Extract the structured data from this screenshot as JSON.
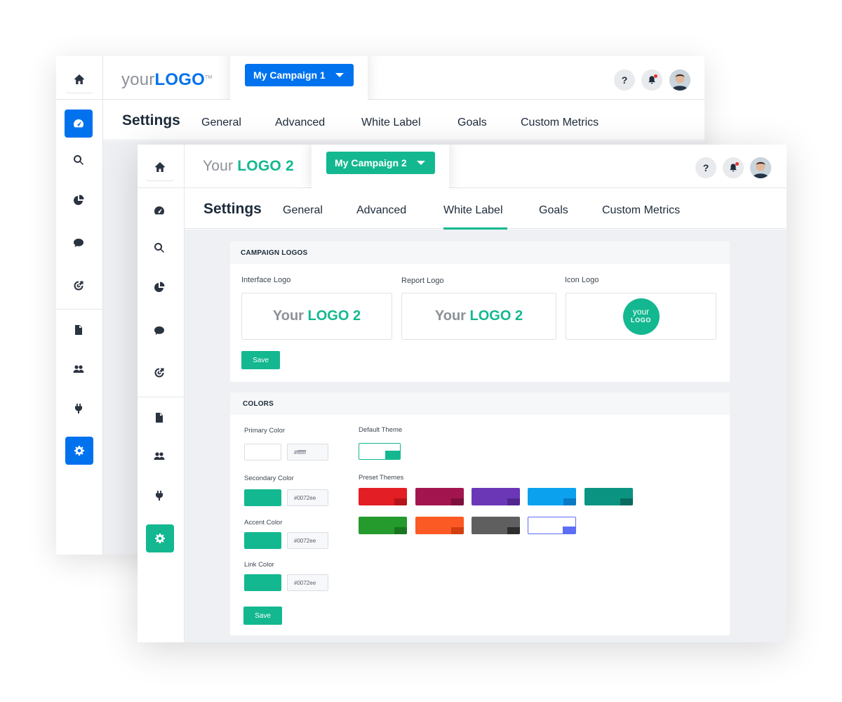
{
  "window1": {
    "logo": {
      "part1": "your",
      "part2": "LOGO",
      "trademark": "TM"
    },
    "campaign_dropdown": {
      "label": "My Campaign 1"
    },
    "header_icons": {
      "help": "?",
      "notifications": "bell-icon",
      "avatar": "avatar"
    },
    "settings_title": "Settings",
    "tabs": [
      {
        "label": "General"
      },
      {
        "label": "Advanced"
      },
      {
        "label": "White Label"
      },
      {
        "label": "Goals"
      },
      {
        "label": "Custom Metrics"
      }
    ],
    "sidebar": [
      "home-icon",
      "dashboard-icon",
      "search-icon",
      "pie-chart-icon",
      "chat-icon",
      "target-icon",
      "file-icon",
      "users-icon",
      "plug-icon",
      "settings-icon"
    ],
    "accent": "#0072ee"
  },
  "window2": {
    "logo": {
      "part1": "Your",
      "part2": "LOGO 2"
    },
    "campaign_dropdown": {
      "label": "My Campaign 2"
    },
    "header_icons": {
      "help": "?",
      "notifications": "bell-icon",
      "avatar": "avatar"
    },
    "settings_title": "Settings",
    "tabs": [
      {
        "label": "General"
      },
      {
        "label": "Advanced"
      },
      {
        "label": "White Label",
        "active": true
      },
      {
        "label": "Goals"
      },
      {
        "label": "Custom Metrics"
      }
    ],
    "sidebar": [
      "home-icon",
      "dashboard-icon",
      "search-icon",
      "pie-chart-icon",
      "chat-icon",
      "target-icon",
      "file-icon",
      "users-icon",
      "plug-icon",
      "settings-icon"
    ],
    "accent": "#13b890",
    "campaign_logos": {
      "heading": "CAMPAIGN LOGOS",
      "interface_logo": {
        "label": "Interface Logo",
        "part1": "Your",
        "part2": "LOGO 2"
      },
      "report_logo": {
        "label": "Report Logo",
        "part1": "Your",
        "part2": "LOGO 2"
      },
      "icon_logo": {
        "label": "Icon Logo",
        "line1": "your",
        "line2": "LOGO"
      },
      "save_label": "Save"
    },
    "colors": {
      "heading": "COLORS",
      "primary": {
        "label": "Primary Color",
        "value": "#ffffff",
        "swatch": "#ffffff"
      },
      "secondary": {
        "label": "Secondary Color",
        "value": "#0072ee",
        "swatch": "#13b890"
      },
      "accent": {
        "label": "Accent Color",
        "value": "#0072ee",
        "swatch": "#13b890"
      },
      "link": {
        "label": "Link Color",
        "value": "#0072ee",
        "swatch": "#13b890"
      },
      "default_theme_label": "Default Theme",
      "default_theme": {
        "main": "#ffffff",
        "tab": "#13b890",
        "border": "#13b890"
      },
      "preset_themes_label": "Preset Themes",
      "preset_themes": [
        {
          "main": "#e31e24",
          "tab": "#b5141a"
        },
        {
          "main": "#a3154f",
          "tab": "#7c0f3b"
        },
        {
          "main": "#6c37b7",
          "tab": "#52268f"
        },
        {
          "main": "#0ba1ef",
          "tab": "#0a7ac4"
        },
        {
          "main": "#0b9482",
          "tab": "#076c5f"
        },
        {
          "main": "#259a2d",
          "tab": "#18761f"
        },
        {
          "main": "#fc5a24",
          "tab": "#d33f10"
        },
        {
          "main": "#5f5f5f",
          "tab": "#2e2e2e"
        },
        {
          "main": "#ffffff",
          "tab": "#5b6ef5",
          "border": "#5b6ef5"
        }
      ],
      "save_label": "Save"
    }
  }
}
